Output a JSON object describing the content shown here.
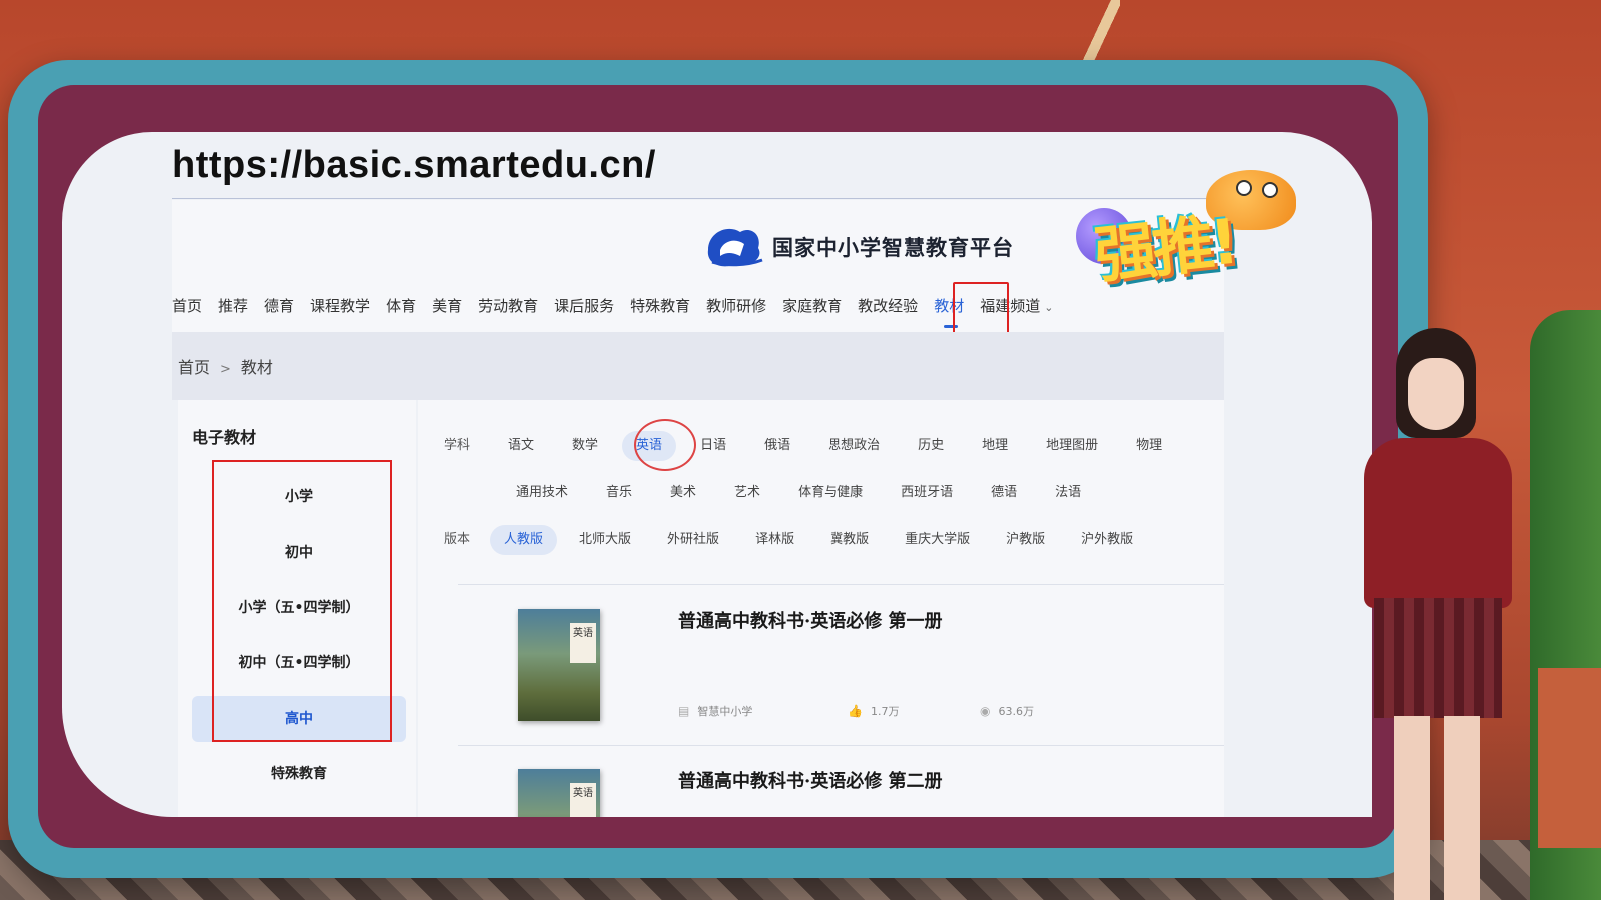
{
  "url": "https://basic.smartedu.cn/",
  "site": {
    "name": "国家中小学智慧教育平台"
  },
  "nav": {
    "items": [
      {
        "label": "首页"
      },
      {
        "label": "推荐"
      },
      {
        "label": "德育"
      },
      {
        "label": "课程教学"
      },
      {
        "label": "体育"
      },
      {
        "label": "美育"
      },
      {
        "label": "劳动教育"
      },
      {
        "label": "课后服务"
      },
      {
        "label": "特殊教育"
      },
      {
        "label": "教师研修"
      },
      {
        "label": "家庭教育"
      },
      {
        "label": "教改经验"
      },
      {
        "label": "教材",
        "active": true
      },
      {
        "label": "福建频道"
      }
    ]
  },
  "breadcrumb": {
    "home": "首页",
    "separator": ">",
    "current": "教材"
  },
  "sidebar": {
    "title": "电子教材",
    "items": [
      {
        "label": "小学"
      },
      {
        "label": "初中"
      },
      {
        "label": "小学（五•四学制）"
      },
      {
        "label": "初中（五•四学制）"
      },
      {
        "label": "高中",
        "active": true
      },
      {
        "label": "特殊教育"
      }
    ]
  },
  "filters": {
    "subject_label": "学科",
    "subjects_row1": [
      "语文",
      "数学",
      "英语",
      "日语",
      "俄语",
      "思想政治",
      "历史",
      "地理",
      "地理图册",
      "物理"
    ],
    "subjects_row2": [
      "通用技术",
      "音乐",
      "美术",
      "艺术",
      "体育与健康",
      "西班牙语",
      "德语",
      "法语"
    ],
    "active_subject": "英语",
    "edition_label": "版本",
    "editions": [
      "人教版",
      "北师大版",
      "外研社版",
      "译林版",
      "冀教版",
      "重庆大学版",
      "沪教版",
      "沪外教版"
    ],
    "active_edition": "人教版"
  },
  "books": [
    {
      "title": "普通高中教科书·英语必修 第一册",
      "cover_label": "英语",
      "publisher": "智慧中小学",
      "likes": "1.7万",
      "views": "63.6万"
    },
    {
      "title": "普通高中教科书·英语必修 第二册",
      "cover_label": "英语"
    }
  ],
  "sticker": {
    "text": "强推!"
  },
  "colors": {
    "accent": "#2a63d6",
    "highlight": "#dd2222",
    "frame": "#4aa0b3",
    "frame_inner": "#7a2a4a"
  }
}
